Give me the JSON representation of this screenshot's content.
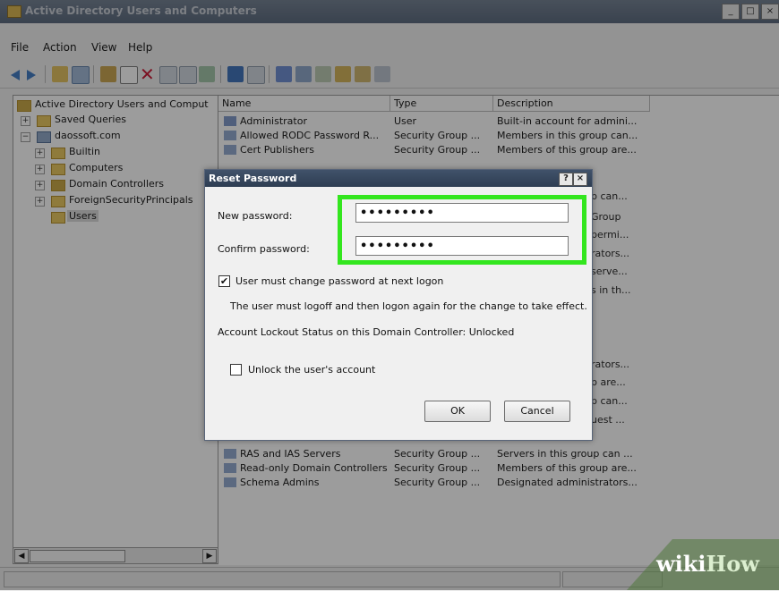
{
  "window": {
    "title": "Active Directory Users and Computers",
    "controls": [
      "_",
      "□",
      "×"
    ]
  },
  "menu": [
    "File",
    "Action",
    "View",
    "Help"
  ],
  "tree": {
    "root": "Active Directory Users and Comput",
    "saved_queries": "Saved Queries",
    "domain": "daossoft.com",
    "builtin": "Builtin",
    "computers": "Computers",
    "domain_controllers": "Domain Controllers",
    "foreign": "ForeignSecurityPrincipals",
    "users": "Users"
  },
  "list": {
    "columns": [
      "Name",
      "Type",
      "Description"
    ],
    "rows": [
      {
        "name": "Administrator",
        "type": "User",
        "desc": "Built-in account for admini..."
      },
      {
        "name": "Allowed RODC Password R...",
        "type": "Security Group ...",
        "desc": "Members in this group can..."
      },
      {
        "name": "Cert Publishers",
        "type": "Security Group ...",
        "desc": "Members of this group are..."
      }
    ],
    "rows_bottom": [
      {
        "name": "RAS and IAS Servers",
        "type": "Security Group ...",
        "desc": "Servers in this group can ..."
      },
      {
        "name": "Read-only Domain Controllers",
        "type": "Security Group ...",
        "desc": "Members of this group are..."
      },
      {
        "name": "Schema Admins",
        "type": "Security Group ...",
        "desc": "Designated administrators..."
      }
    ],
    "partial": [
      "p can...",
      "Group",
      "permi...",
      "rators...",
      "serve...",
      "s in th...",
      "rators...",
      "p are...",
      "p can...",
      "uest ..."
    ]
  },
  "dialog": {
    "title": "Reset Password",
    "help_btn": "?",
    "close_btn": "×",
    "new_label": "New password:",
    "new_value": "•••••••••",
    "confirm_label": "Confirm password:",
    "confirm_value": "•••••••••",
    "must_change_label": "User must change password at next logon",
    "must_change_checked": "✔",
    "info_text": "The user must logoff and then logon again for the change to take effect.",
    "lockout_text": "Account Lockout Status on this Domain Controller: Unlocked",
    "unlock_label": "Unlock the user's account",
    "ok": "OK",
    "cancel": "Cancel"
  },
  "watermark": {
    "wiki": "wiki",
    "how": "How"
  },
  "colors": {
    "highlight": "#33e61e",
    "dialog_title": "#2e3d52"
  }
}
